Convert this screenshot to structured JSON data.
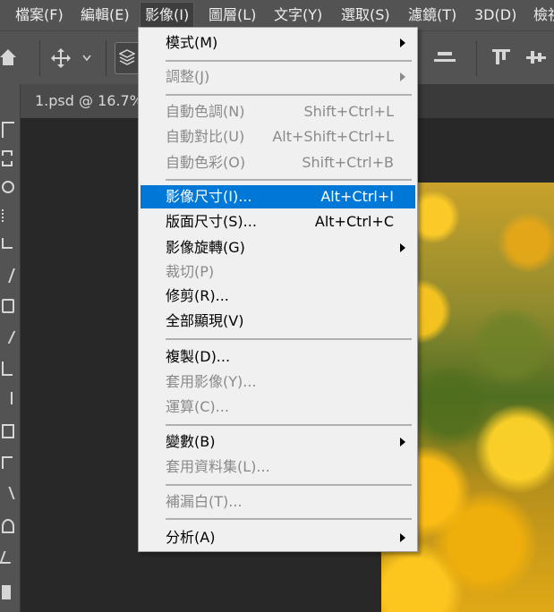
{
  "menubar": {
    "items": [
      "檔案(F)",
      "編輯(E)",
      "影像(I)",
      "圖層(L)",
      "文字(Y)",
      "選取(S)",
      "濾鏡(T)",
      "3D(D)",
      "檢視"
    ],
    "active_index": 2
  },
  "document_tab": {
    "title": "1.psd @ 16.7%"
  },
  "colors": {
    "highlight": "#0078d7",
    "menu_bg": "#f0f0f0",
    "disabled_text": "#8a8a8a",
    "ui_gray": "#535353"
  },
  "image_menu": {
    "items": [
      {
        "label": "模式(M)",
        "shortcut": "",
        "submenu": true,
        "disabled": false,
        "highlighted": false
      },
      {
        "label": "調整(J)",
        "shortcut": "",
        "submenu": true,
        "disabled": true,
        "highlighted": false
      },
      {
        "label": "自動色調(N)",
        "shortcut": "Shift+Ctrl+L",
        "submenu": false,
        "disabled": true,
        "highlighted": false
      },
      {
        "label": "自動對比(U)",
        "shortcut": "Alt+Shift+Ctrl+L",
        "submenu": false,
        "disabled": true,
        "highlighted": false
      },
      {
        "label": "自動色彩(O)",
        "shortcut": "Shift+Ctrl+B",
        "submenu": false,
        "disabled": true,
        "highlighted": false
      },
      {
        "label": "影像尺寸(I)...",
        "shortcut": "Alt+Ctrl+I",
        "submenu": false,
        "disabled": false,
        "highlighted": true
      },
      {
        "label": "版面尺寸(S)...",
        "shortcut": "Alt+Ctrl+C",
        "submenu": false,
        "disabled": false,
        "highlighted": false
      },
      {
        "label": "影像旋轉(G)",
        "shortcut": "",
        "submenu": true,
        "disabled": false,
        "highlighted": false
      },
      {
        "label": "裁切(P)",
        "shortcut": "",
        "submenu": false,
        "disabled": true,
        "highlighted": false
      },
      {
        "label": "修剪(R)...",
        "shortcut": "",
        "submenu": false,
        "disabled": false,
        "highlighted": false
      },
      {
        "label": "全部顯現(V)",
        "shortcut": "",
        "submenu": false,
        "disabled": false,
        "highlighted": false
      },
      {
        "label": "複製(D)...",
        "shortcut": "",
        "submenu": false,
        "disabled": false,
        "highlighted": false
      },
      {
        "label": "套用影像(Y)...",
        "shortcut": "",
        "submenu": false,
        "disabled": true,
        "highlighted": false
      },
      {
        "label": "運算(C)...",
        "shortcut": "",
        "submenu": false,
        "disabled": true,
        "highlighted": false
      },
      {
        "label": "變數(B)",
        "shortcut": "",
        "submenu": true,
        "disabled": false,
        "highlighted": false
      },
      {
        "label": "套用資料集(L)...",
        "shortcut": "",
        "submenu": false,
        "disabled": true,
        "highlighted": false
      },
      {
        "label": "補漏白(T)...",
        "shortcut": "",
        "submenu": false,
        "disabled": true,
        "highlighted": false
      },
      {
        "label": "分析(A)",
        "shortcut": "",
        "submenu": true,
        "disabled": false,
        "highlighted": false
      }
    ]
  },
  "toolbar": {
    "icons": [
      "home-icon",
      "move-tool-icon",
      "chevron-down-icon",
      "layers-icon",
      "align-center-icon",
      "align-top-icon",
      "align-vertical-center-icon"
    ]
  }
}
